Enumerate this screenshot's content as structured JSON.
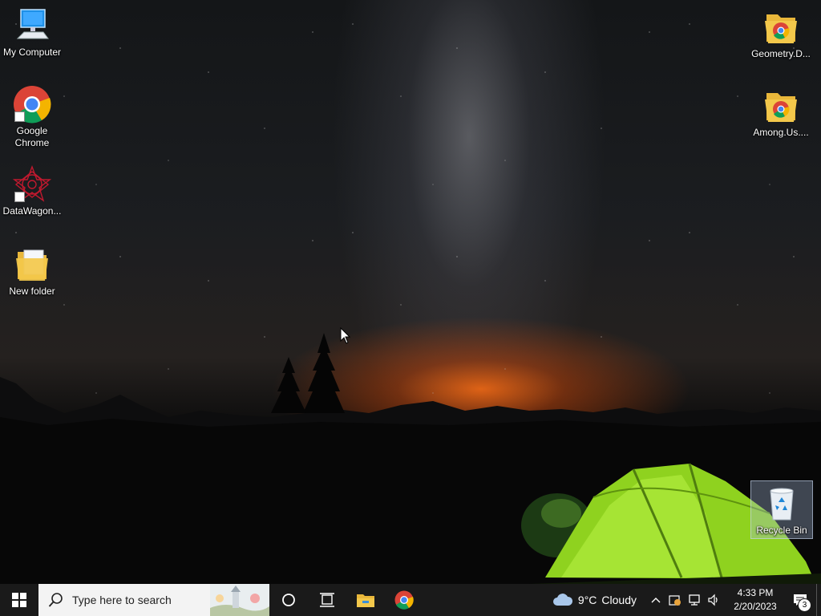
{
  "desktop": {
    "icons_left": [
      {
        "label": "My Computer"
      },
      {
        "label": "Google Chrome"
      },
      {
        "label": "DataWagon..."
      },
      {
        "label": "New folder"
      }
    ],
    "icons_right": [
      {
        "label": "Geometry.D..."
      },
      {
        "label": "Among.Us...."
      },
      {
        "label": "Recycle Bin"
      }
    ]
  },
  "taskbar": {
    "search_placeholder": "Type here to search",
    "weather": {
      "temp": "9°C",
      "condition": "Cloudy"
    },
    "clock": {
      "time": "4:33 PM",
      "date": "2/20/2023"
    },
    "notification_count": "3"
  },
  "colors": {
    "taskbar": "#1a1a1a",
    "search_bg": "#f3f3f3",
    "tent_green": "#8fd21f",
    "folder_yellow": "#f3c84b"
  }
}
